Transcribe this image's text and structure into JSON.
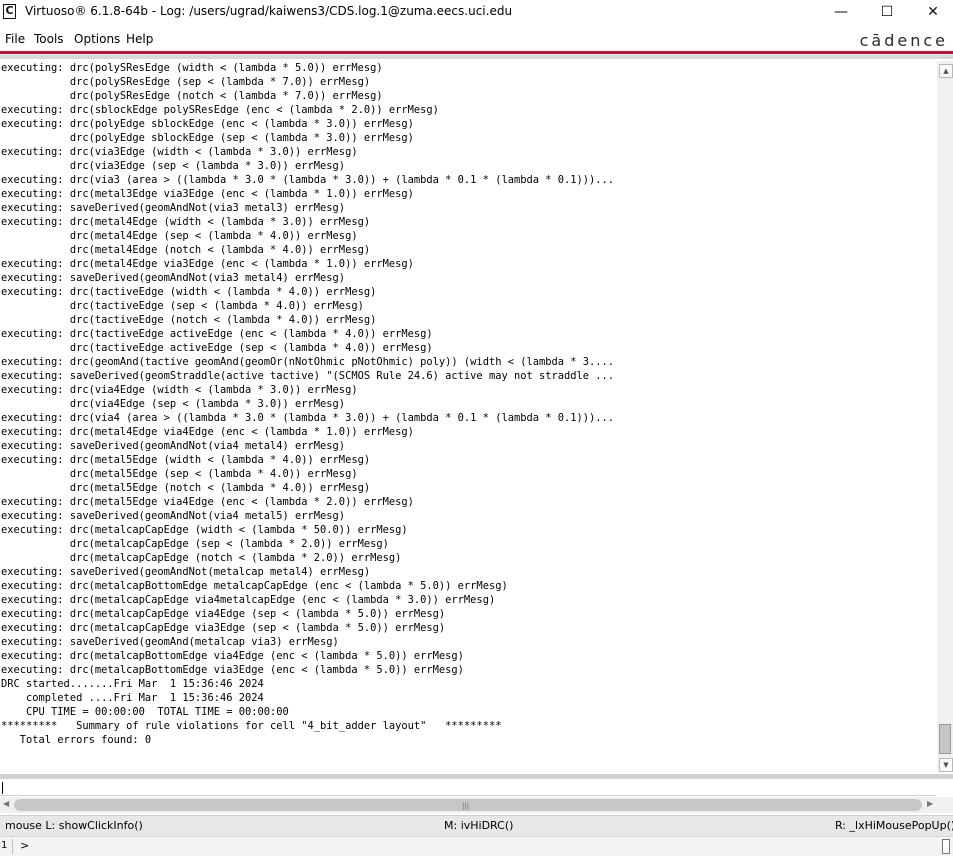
{
  "window": {
    "app_icon": "cadence-c-icon",
    "title": "Virtuoso® 6.1.8-64b - Log: /users/ugrad/kaiwens3/CDS.log.1@zuma.eecs.uci.edu",
    "controls": {
      "minimize": "—",
      "maximize": "☐",
      "close": "✕"
    }
  },
  "menu": {
    "items": [
      "File",
      "Tools",
      "Options",
      "Help"
    ],
    "brand": "cādence",
    "accent_color": "#c8102e"
  },
  "log": {
    "lines": [
      "executing: drc(polySResEdge (width < (lambda * 5.0)) errMesg)",
      "           drc(polySResEdge (sep < (lambda * 7.0)) errMesg)",
      "           drc(polySResEdge (notch < (lambda * 7.0)) errMesg)",
      "executing: drc(sblockEdge polySResEdge (enc < (lambda * 2.0)) errMesg)",
      "executing: drc(polyEdge sblockEdge (enc < (lambda * 3.0)) errMesg)",
      "           drc(polyEdge sblockEdge (sep < (lambda * 3.0)) errMesg)",
      "executing: drc(via3Edge (width < (lambda * 3.0)) errMesg)",
      "           drc(via3Edge (sep < (lambda * 3.0)) errMesg)",
      "executing: drc(via3 (area > ((lambda * 3.0 * (lambda * 3.0)) + (lambda * 0.1 * (lambda * 0.1)))...",
      "executing: drc(metal3Edge via3Edge (enc < (lambda * 1.0)) errMesg)",
      "executing: saveDerived(geomAndNot(via3 metal3) errMesg)",
      "executing: drc(metal4Edge (width < (lambda * 3.0)) errMesg)",
      "           drc(metal4Edge (sep < (lambda * 4.0)) errMesg)",
      "           drc(metal4Edge (notch < (lambda * 4.0)) errMesg)",
      "executing: drc(metal4Edge via3Edge (enc < (lambda * 1.0)) errMesg)",
      "executing: saveDerived(geomAndNot(via3 metal4) errMesg)",
      "executing: drc(tactiveEdge (width < (lambda * 4.0)) errMesg)",
      "           drc(tactiveEdge (sep < (lambda * 4.0)) errMesg)",
      "           drc(tactiveEdge (notch < (lambda * 4.0)) errMesg)",
      "executing: drc(tactiveEdge activeEdge (enc < (lambda * 4.0)) errMesg)",
      "           drc(tactiveEdge activeEdge (sep < (lambda * 4.0)) errMesg)",
      "executing: drc(geomAnd(tactive geomAnd(geomOr(nNotOhmic pNotOhmic) poly)) (width < (lambda * 3....",
      "executing: saveDerived(geomStraddle(active tactive) \"(SCMOS Rule 24.6) active may not straddle ...",
      "executing: drc(via4Edge (width < (lambda * 3.0)) errMesg)",
      "           drc(via4Edge (sep < (lambda * 3.0)) errMesg)",
      "executing: drc(via4 (area > ((lambda * 3.0 * (lambda * 3.0)) + (lambda * 0.1 * (lambda * 0.1)))...",
      "executing: drc(metal4Edge via4Edge (enc < (lambda * 1.0)) errMesg)",
      "executing: saveDerived(geomAndNot(via4 metal4) errMesg)",
      "executing: drc(metal5Edge (width < (lambda * 4.0)) errMesg)",
      "           drc(metal5Edge (sep < (lambda * 4.0)) errMesg)",
      "           drc(metal5Edge (notch < (lambda * 4.0)) errMesg)",
      "executing: drc(metal5Edge via4Edge (enc < (lambda * 2.0)) errMesg)",
      "executing: saveDerived(geomAndNot(via4 metal5) errMesg)",
      "executing: drc(metalcapCapEdge (width < (lambda * 50.0)) errMesg)",
      "           drc(metalcapCapEdge (sep < (lambda * 2.0)) errMesg)",
      "           drc(metalcapCapEdge (notch < (lambda * 2.0)) errMesg)",
      "executing: saveDerived(geomAndNot(metalcap metal4) errMesg)",
      "executing: drc(metalcapBottomEdge metalcapCapEdge (enc < (lambda * 5.0)) errMesg)",
      "executing: drc(metalcapCapEdge via4metalcapEdge (enc < (lambda * 3.0)) errMesg)",
      "executing: drc(metalcapCapEdge via4Edge (sep < (lambda * 5.0)) errMesg)",
      "executing: drc(metalcapCapEdge via3Edge (sep < (lambda * 5.0)) errMesg)",
      "executing: saveDerived(geomAnd(metalcap via3) errMesg)",
      "executing: drc(metalcapBottomEdge via4Edge (enc < (lambda * 5.0)) errMesg)",
      "executing: drc(metalcapBottomEdge via3Edge (enc < (lambda * 5.0)) errMesg)",
      "DRC started.......Fri Mar  1 15:36:46 2024",
      "    completed ....Fri Mar  1 15:36:46 2024",
      "    CPU TIME = 00:00:00  TOTAL TIME = 00:00:00",
      "*********   Summary of rule violations for cell \"4_bit_adder layout\"   *********",
      "   Total errors found: 0"
    ]
  },
  "input": {
    "value": ""
  },
  "status": {
    "left": "mouse L: showClickInfo()",
    "middle": "M: ivHiDRC()",
    "right": "R: _lxHiMousePopUp()"
  },
  "prompt": {
    "number": "1",
    "symbol": ">"
  }
}
